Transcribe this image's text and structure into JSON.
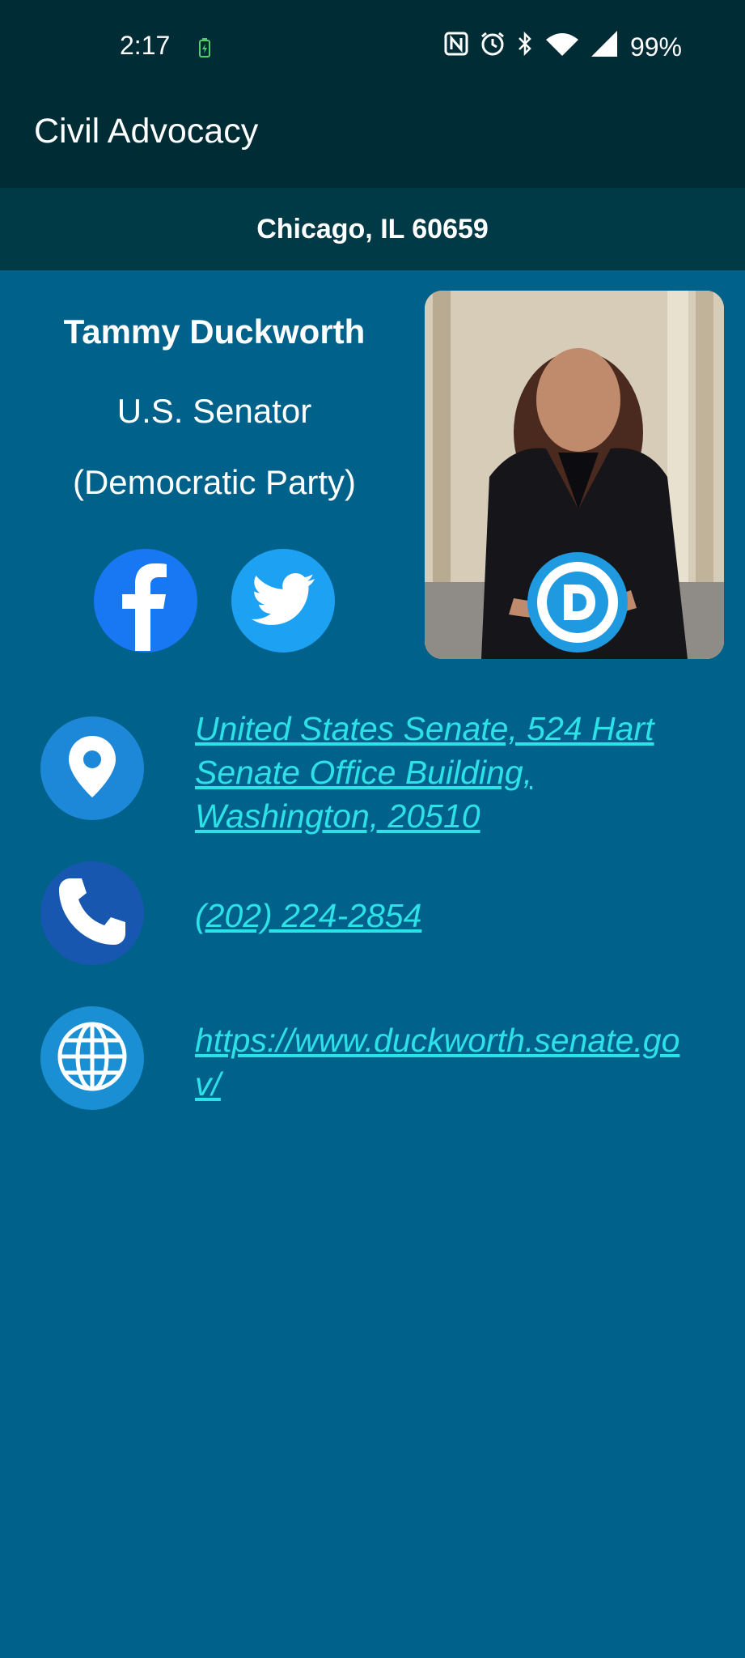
{
  "status_bar": {
    "time": "2:17",
    "battery": "99%"
  },
  "app": {
    "title": "Civil Advocacy",
    "location": "Chicago, IL 60659"
  },
  "official": {
    "name": "Tammy Duckworth",
    "office": "U.S. Senator",
    "party": "(Democratic Party)",
    "party_badge_letter": "D"
  },
  "social": [
    {
      "name": "facebook-icon",
      "color": "#1877f2"
    },
    {
      "name": "twitter-icon",
      "color": "#1da1f2"
    }
  ],
  "contact": {
    "address": "United States Senate, 524 Hart Senate Office Building, Washington, 20510",
    "phone": "(202) 224-2854",
    "website": "https://www.duckworth.senate.gov/"
  },
  "colors": {
    "background": "#00628a",
    "app_bar": "#002d35",
    "location_bar": "#003a47",
    "link": "#2ce1e8"
  }
}
